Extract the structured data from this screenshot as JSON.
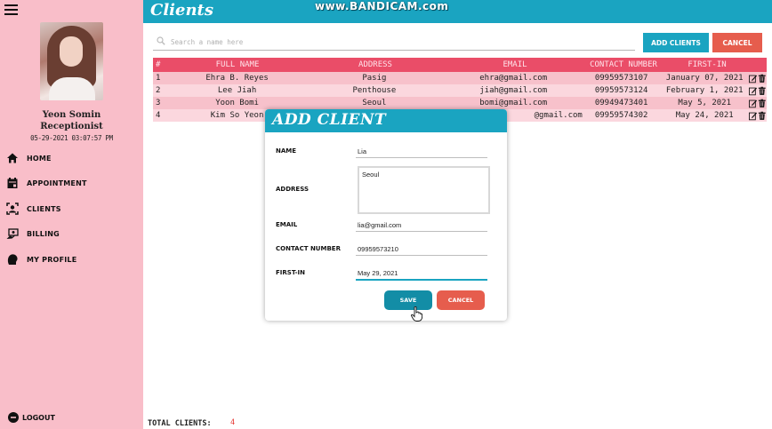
{
  "header": {
    "title": "Clients",
    "watermark": "www.BANDICAM.com"
  },
  "sidebar": {
    "user": {
      "name": "Yeon Somin",
      "role": "Receptionist",
      "datetime": "05-29-2021 03:07:57 PM"
    },
    "items": [
      {
        "label": "HOME",
        "icon": "home-icon"
      },
      {
        "label": "APPOINTMENT",
        "icon": "calendar-icon"
      },
      {
        "label": "CLIENTS",
        "icon": "clients-icon"
      },
      {
        "label": "BILLING",
        "icon": "billing-icon"
      },
      {
        "label": "MY PROFILE",
        "icon": "profile-icon"
      }
    ],
    "logout": "LOGOUT"
  },
  "search": {
    "placeholder": "Search a name here"
  },
  "toolbar": {
    "add_label": "ADD CLIENTS",
    "cancel_label": "CANCEL"
  },
  "table": {
    "headers": [
      "#",
      "FULL NAME",
      "ADDRESS",
      "EMAIL",
      "CONTACT NUMBER",
      "FIRST-IN"
    ],
    "rows": [
      [
        "1",
        "Ehra B. Reyes",
        "Pasig",
        "ehra@gmail.com",
        "09959573107",
        "January 07, 2021"
      ],
      [
        "2",
        "Lee Jiah",
        "Penthouse",
        "jiah@gmail.com",
        "09959573124",
        "February 1, 2021"
      ],
      [
        "3",
        "Yoon Bomi",
        "Seoul",
        "bomi@gmail.com",
        "09949473401",
        "May 5, 2021"
      ],
      [
        "4",
        "Kim So Yeon",
        "",
        "@gmail.com",
        "09959574302",
        "May 24, 2021"
      ]
    ]
  },
  "modal": {
    "title": "ADD CLIENT",
    "fields": {
      "name_label": "NAME",
      "name_value": "Lia",
      "address_label": "ADDRESS",
      "address_value": "Seoul",
      "email_label": "EMAIL",
      "email_value": "lia@gmail.com",
      "contact_label": "CONTACT NUMBER",
      "contact_value": "09959573210",
      "firstin_label": "FIRST-IN",
      "firstin_value": "May 29, 2021"
    },
    "save_label": "SAVE",
    "cancel_label": "CANCEL"
  },
  "footer": {
    "total_label": "TOTAL CLIENTS:",
    "total_value": "4"
  },
  "colors": {
    "accent": "#1aa4c1",
    "danger": "#e65d4d",
    "sidebar": "#f9bec9",
    "table_header": "#ea4d68"
  }
}
